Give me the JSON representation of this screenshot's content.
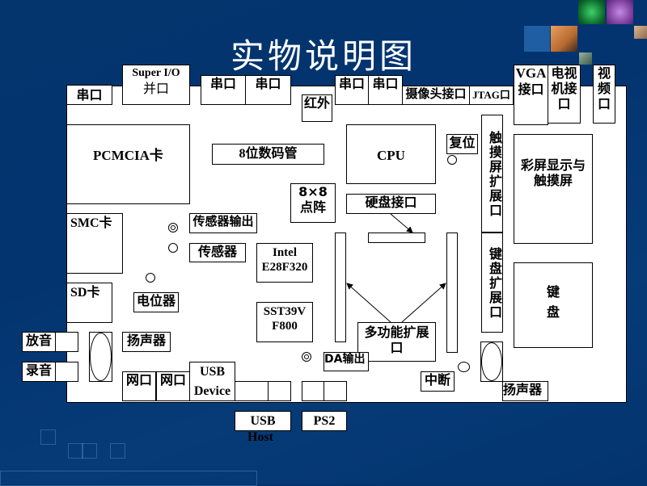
{
  "title": "实物说明图",
  "colors": {
    "background": "#03346e",
    "board": "#ffffff",
    "line": "#000000",
    "title_text": "#ffffff"
  },
  "top_connectors": {
    "serial_1": "串口",
    "super_io_line1": "Super I/O",
    "super_io_line2": "并口",
    "serial_2": "串口",
    "serial_3": "串口",
    "infrared": "红外",
    "serial_4": "串口",
    "serial_5": "串口",
    "camera": "摄像头接口",
    "jtag": "JTAG口",
    "vga_line1": "VGA",
    "vga_line2": "接口",
    "tv_line1": "电视",
    "tv_line2": "机接",
    "tv_line3": "口",
    "video_line1": "视",
    "video_line2": "频",
    "video_line3": "口"
  },
  "components": {
    "pcmcia": "PCMCIA卡",
    "seg_display": "8位数码管",
    "cpu": "CPU",
    "reset": "复位",
    "dot_matrix_line1": "8×8",
    "dot_matrix_line2": "点阵",
    "hdd_interface": "硬盘接口",
    "touch_expansion": "触摸屏扩展口",
    "color_lcd_line1": "彩屏显示与",
    "color_lcd_line2": "触摸屏",
    "smc": "SMC卡",
    "sensor_output": "传感器输出",
    "sensor": "传感器",
    "intel_line1": "Intel",
    "intel_line2": "E28F320",
    "keyboard_expansion": "键盘扩展口",
    "keyboard_line1": "键",
    "keyboard_line2": "盘",
    "sd": "SD卡",
    "potentiometer": "电位器",
    "sst_line1": "SST39V",
    "sst_line2": "F800",
    "multi_expansion_line1": "多功能扩展",
    "multi_expansion_line2": "口",
    "speaker_left": "扬声器",
    "playback": "放音",
    "record": "录音",
    "da_output": "DA输出",
    "interrupt": "中断",
    "speaker_right": "扬声器",
    "network_1": "网口",
    "network_2": "网口",
    "usb_device_line1": "USB",
    "usb_device_line2": "Device"
  },
  "bottom_labels": {
    "usb_host_line1": "USB",
    "usb_host_line2": "Host",
    "ps2": "PS2"
  }
}
